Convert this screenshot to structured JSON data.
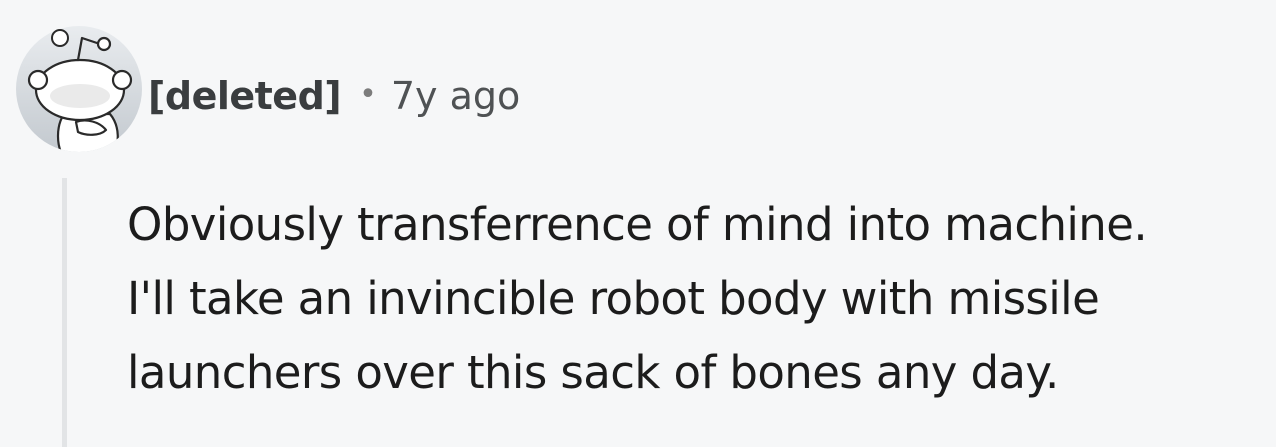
{
  "comment": {
    "author": "[deleted]",
    "separator": "•",
    "timestamp": "7y ago",
    "body_lines": [
      "Obviously transferrence of mind into machine.",
      "I'll take an invincible robot body with missile",
      "launchers over this sack of bones any day."
    ],
    "avatar_icon": "reddit-snoo-default-avatar-icon"
  },
  "colors": {
    "background": "#f6f7f8",
    "author_text": "#3a3d3f",
    "meta_text": "#4f5254",
    "body_text": "#1c1c1c",
    "thread_line": "#e2e4e6"
  }
}
